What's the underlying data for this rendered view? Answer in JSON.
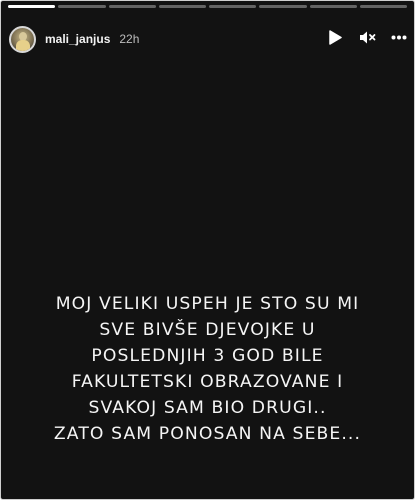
{
  "story": {
    "progress_segments": [
      1.0,
      0.0,
      0.0,
      0.0,
      0.0,
      0.0,
      0.0,
      0.0
    ],
    "username": "mali_janjus",
    "time": "22h",
    "controls": {
      "play_icon": "play-icon",
      "mute_icon": "mute-icon",
      "more_icon": "more-options-icon"
    },
    "text_lines": [
      "MOJ VELIKI USPEH JE STO SU MI",
      "SVE BIVŠE DJEVOJKE U",
      "POSLEDNJIH 3 GOD BILE",
      "FAKULTETSKI OBRAZOVANE I",
      "SVAKOJ SAM BIO DRUGI..",
      "ZATO SAM PONOSAN NA SEBE..."
    ]
  },
  "colors": {
    "background": "#121212",
    "text": "#f5f5f5",
    "secondary_text": "#bdbdbd"
  }
}
